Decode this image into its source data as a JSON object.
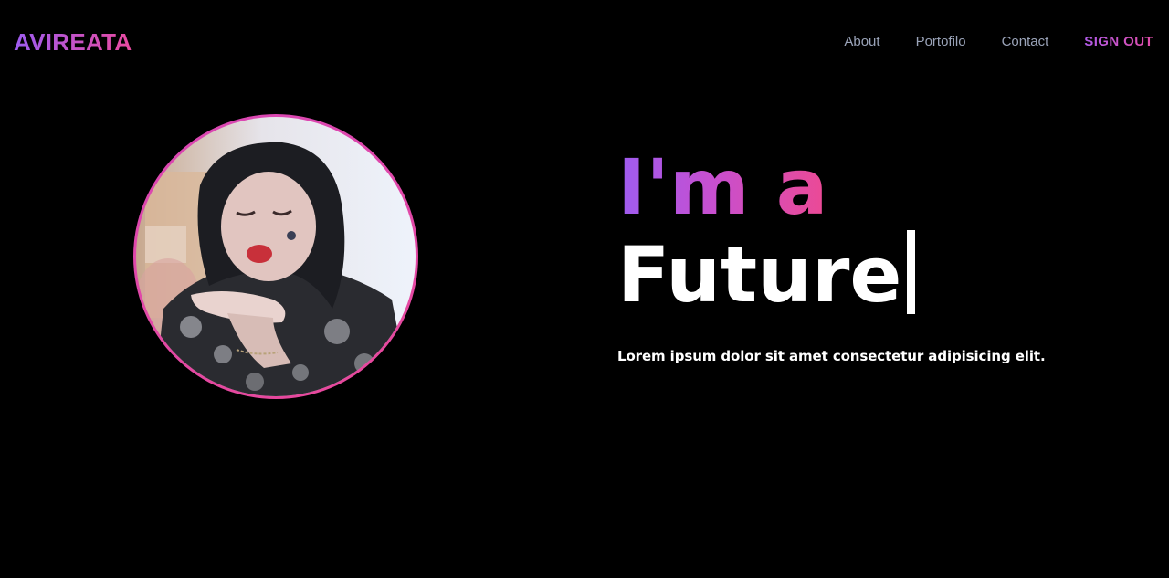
{
  "brand": {
    "logo_text": "AVIREATA"
  },
  "nav": {
    "links": [
      {
        "label": "About"
      },
      {
        "label": "Portofilo"
      },
      {
        "label": "Contact"
      }
    ],
    "signout_label": "SIGN OUT"
  },
  "hero": {
    "headline_prefix": "I'm a",
    "headline_word": "Future",
    "subtitle": "Lorem ipsum dolor sit amet consectetur adipisicing elit."
  },
  "colors": {
    "background": "#000000",
    "gradient_start": "#9d5cf0",
    "gradient_end": "#e94aa0",
    "nav_text": "#9aa3b8",
    "text_primary": "#ffffff"
  },
  "icons": {
    "text_cursor": "text-cursor-icon"
  }
}
